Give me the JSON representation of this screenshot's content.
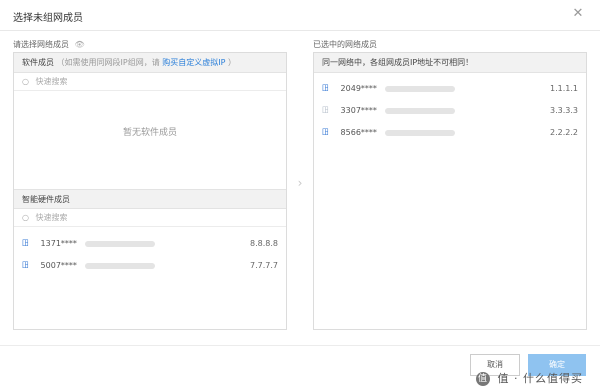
{
  "dialog": {
    "title": "选择未组网成员"
  },
  "left": {
    "section_label": "请选择网络成员",
    "software": {
      "title": "软件成员",
      "hint": "（如需使用同网段IP组网，请",
      "link": "购买自定义虚拟IP",
      "hint_end": "）",
      "search_placeholder": "快速搜索",
      "empty_text": "暂无软件成员"
    },
    "hardware": {
      "title": "智能硬件成员",
      "search_placeholder": "快速搜索",
      "items": [
        {
          "id": "1371****",
          "ip": "8.8.8.8",
          "icon": "router-icon"
        },
        {
          "id": "5007****",
          "ip": "7.7.7.7",
          "icon": "router-icon"
        }
      ]
    }
  },
  "right": {
    "section_label": "已选中的网络成员",
    "header": "同一网络中，各组网成员IP地址不可相同！",
    "items": [
      {
        "id": "2049****",
        "ip": "1.1.1.1",
        "icon": "router-icon"
      },
      {
        "id": "3307****",
        "ip": "3.3.3.3",
        "icon": "router-icon"
      },
      {
        "id": "8566****",
        "ip": "2.2.2.2",
        "icon": "router-icon"
      }
    ]
  },
  "footer": {
    "cancel_label": "取消",
    "confirm_label": "确定"
  },
  "watermark": {
    "text": "值 · 什么值得买"
  },
  "colors": {
    "accent": "#2b7fd9",
    "confirm_button": "#8fc3f0",
    "panel_header": "#f2f2f2"
  }
}
